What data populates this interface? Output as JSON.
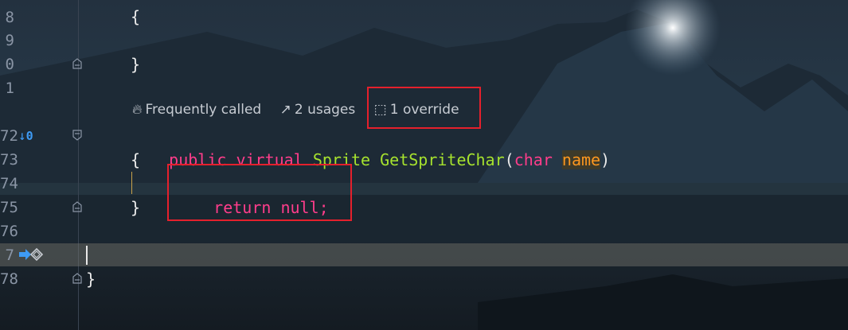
{
  "editor": {
    "line_numbers": [
      "8",
      "9",
      "0",
      "1",
      "72",
      "73",
      "74",
      "75",
      "76",
      "7",
      "78"
    ],
    "lines": {
      "l1": "{",
      "l3": "}",
      "l_close": "}",
      "l_body": "{",
      "l_close2": "}",
      "l_final": "}"
    },
    "signature": {
      "kw1": "public",
      "kw2": "virtual",
      "type": "Sprite",
      "method": "GetSpriteChar",
      "open": "(",
      "ptype": "char",
      "pname": "name",
      "close": ")"
    },
    "body_stmt": {
      "kw": "return",
      "val": "null;"
    },
    "inlay_hints": {
      "frequently_called": "Frequently called",
      "usages": "2 usages",
      "override": "1 override"
    },
    "gutter_markers": {
      "override_count": "0"
    }
  },
  "colors": {
    "keyword": "#ff3d8b",
    "type": "#a6e22e",
    "param": "#fd971f",
    "highlight_box": "#e5202c"
  }
}
